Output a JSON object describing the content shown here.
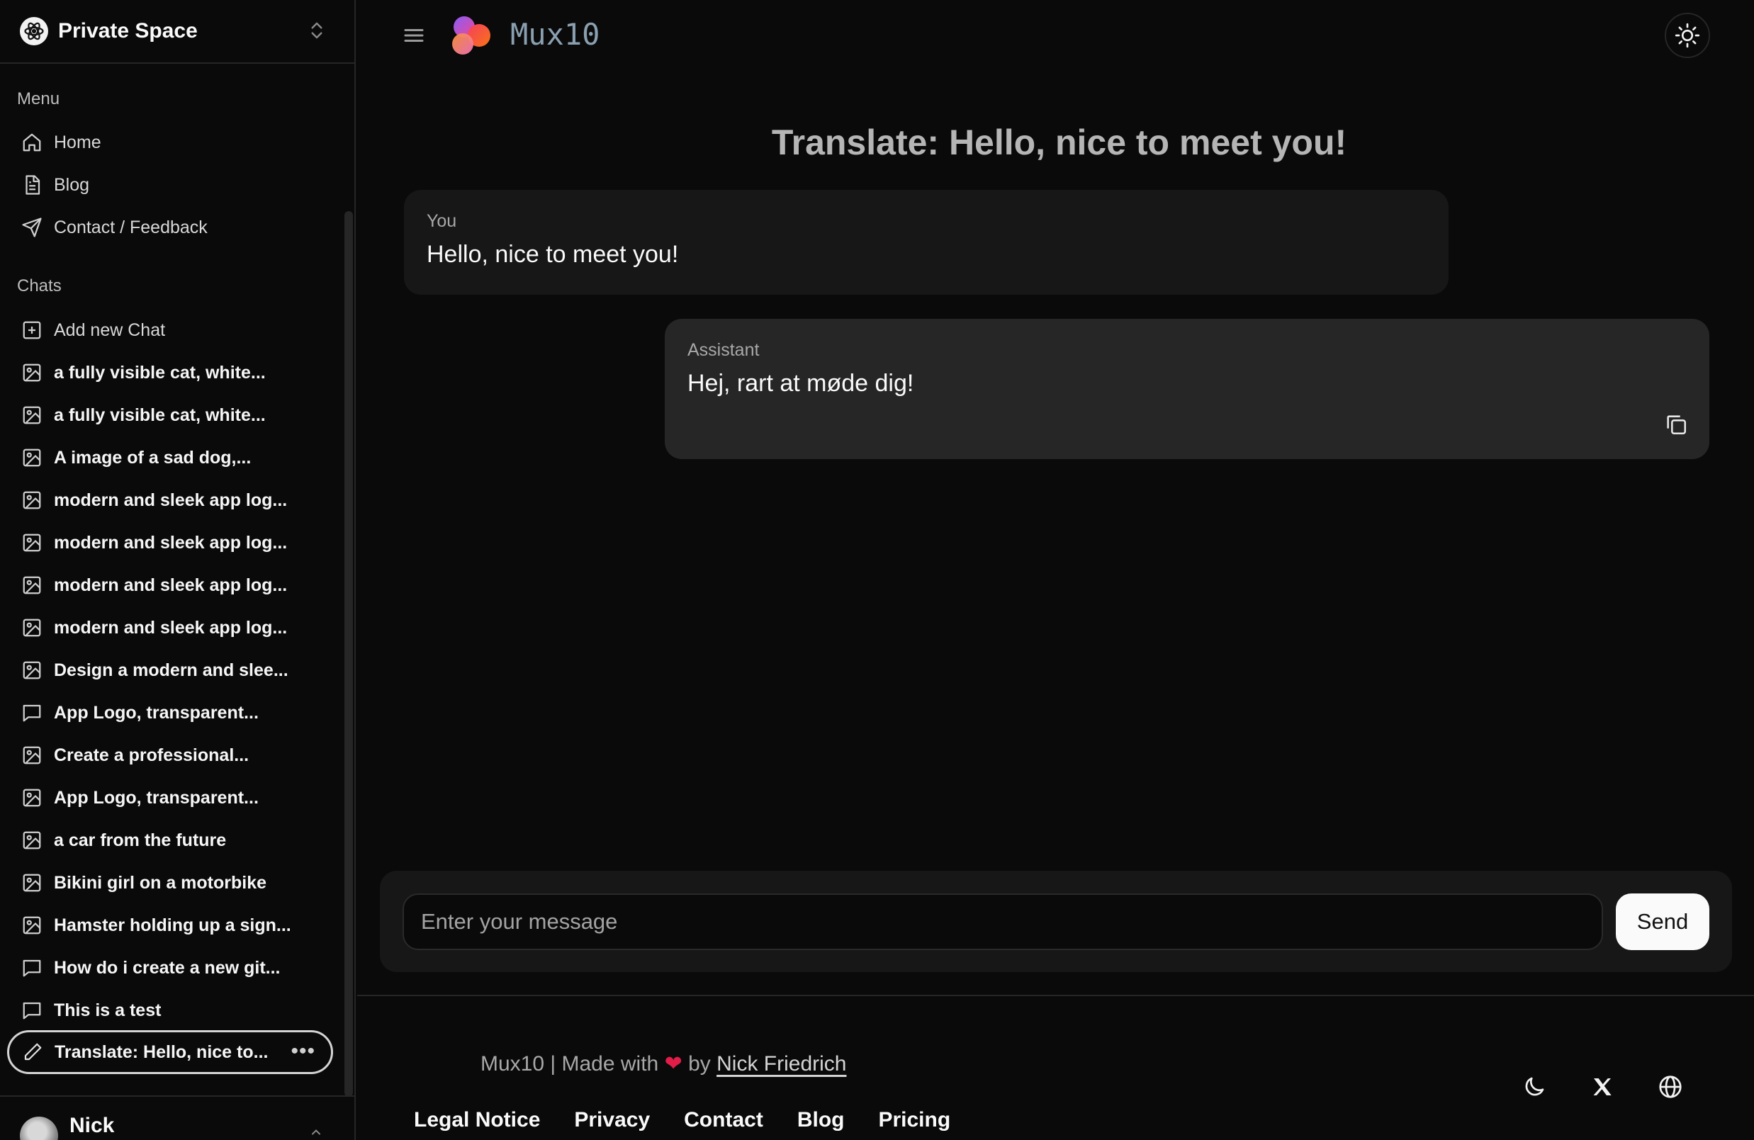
{
  "space": {
    "name": "Private Space"
  },
  "menu": {
    "label": "Menu",
    "items": [
      {
        "label": "Home",
        "icon": "home-icon"
      },
      {
        "label": "Blog",
        "icon": "document-icon"
      },
      {
        "label": "Contact / Feedback",
        "icon": "send-icon"
      }
    ]
  },
  "chats": {
    "label": "Chats",
    "add_label": "Add new Chat",
    "items": [
      {
        "label": "a fully visible cat, white...",
        "icon": "image-icon"
      },
      {
        "label": "a fully visible cat, white...",
        "icon": "image-icon"
      },
      {
        "label": "A image of a sad dog,...",
        "icon": "image-icon"
      },
      {
        "label": "modern and sleek app log...",
        "icon": "image-icon"
      },
      {
        "label": "modern and sleek app log...",
        "icon": "image-icon"
      },
      {
        "label": "modern and sleek app log...",
        "icon": "image-icon"
      },
      {
        "label": "modern and sleek app log...",
        "icon": "image-icon"
      },
      {
        "label": "Design a modern and slee...",
        "icon": "image-icon"
      },
      {
        "label": "App Logo, transparent...",
        "icon": "message-icon"
      },
      {
        "label": "Create a professional...",
        "icon": "image-icon"
      },
      {
        "label": "App Logo, transparent...",
        "icon": "image-icon"
      },
      {
        "label": "a car from the future",
        "icon": "image-icon"
      },
      {
        "label": "Bikini girl on a motorbike",
        "icon": "image-icon"
      },
      {
        "label": "Hamster holding up a sign...",
        "icon": "image-icon"
      },
      {
        "label": "How do i create a new git...",
        "icon": "message-icon"
      },
      {
        "label": "This is a test",
        "icon": "message-icon"
      }
    ],
    "active": {
      "label": "Translate: Hello, nice to...",
      "icon": "pencil-icon",
      "more": "•••"
    }
  },
  "user": {
    "name": "Nick"
  },
  "header": {
    "brand": "Mux10"
  },
  "conversation": {
    "title": "Translate: Hello, nice to meet you!",
    "messages": [
      {
        "role": "You",
        "text": "Hello, nice to meet you!"
      },
      {
        "role": "Assistant",
        "text": "Hej, rart at møde dig!"
      }
    ]
  },
  "composer": {
    "placeholder": "Enter your message",
    "send_label": "Send"
  },
  "footer": {
    "prefix": "Mux10 | Made with",
    "heart": "❤",
    "by": "by",
    "author": "Nick Friedrich",
    "links": [
      "Legal Notice",
      "Privacy",
      "Contact",
      "Blog",
      "Pricing"
    ]
  },
  "colors": {
    "background": "#0a0a0a",
    "panel": "#171717",
    "assistant_bubble": "#262626",
    "brand_text": "#8aa0b0",
    "heart": "#e11d48"
  }
}
